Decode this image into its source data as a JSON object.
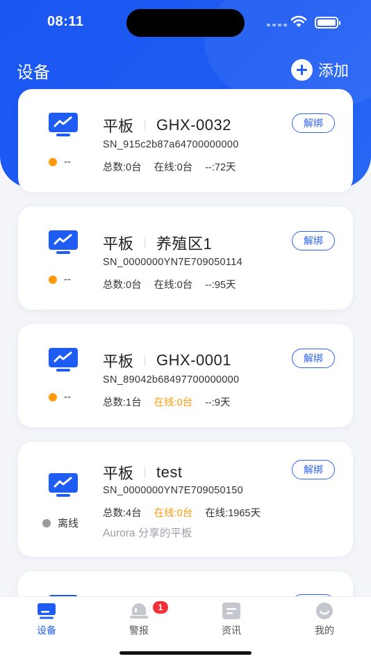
{
  "status_bar": {
    "time": "08:11"
  },
  "header": {
    "title": "设备",
    "add_label": "添加"
  },
  "devices": [
    {
      "type": "平板",
      "name": "GHX-0032",
      "sn": "SN_915c2b87a64700000000",
      "status_text": "--",
      "status_color": "#ff9a0e",
      "stats": [
        {
          "text": "总数:0台",
          "highlight": false
        },
        {
          "text": "在线:0台",
          "highlight": false
        },
        {
          "text": "--:72天",
          "highlight": false
        }
      ],
      "shared": "",
      "unbind_label": "解绑"
    },
    {
      "type": "平板",
      "name": "养殖区1",
      "sn": "SN_0000000YN7E709050114",
      "status_text": "--",
      "status_color": "#ff9a0e",
      "stats": [
        {
          "text": "总数:0台",
          "highlight": false
        },
        {
          "text": "在线:0台",
          "highlight": false
        },
        {
          "text": "--:95天",
          "highlight": false
        }
      ],
      "shared": "",
      "unbind_label": "解绑"
    },
    {
      "type": "平板",
      "name": "GHX-0001",
      "sn": "SN_89042b68497700000000",
      "status_text": "--",
      "status_color": "#ff9a0e",
      "stats": [
        {
          "text": "总数:1台",
          "highlight": false
        },
        {
          "text": "在线:0台",
          "highlight": true
        },
        {
          "text": "--:9天",
          "highlight": false
        }
      ],
      "shared": "",
      "unbind_label": "解绑"
    },
    {
      "type": "平板",
      "name": "test",
      "sn": "SN_0000000YN7E709050150",
      "status_text": "离线",
      "status_color": "#9a9a9a",
      "stats": [
        {
          "text": "总数:4台",
          "highlight": false
        },
        {
          "text": "在线:0台",
          "highlight": true
        },
        {
          "text": "在线:1965天",
          "highlight": false
        }
      ],
      "shared": "Aurora 分享的平板",
      "unbind_label": "解绑"
    }
  ],
  "tabs": [
    {
      "label": "设备",
      "icon": "device-icon",
      "active": true
    },
    {
      "label": "警报",
      "icon": "alarm-icon",
      "active": false,
      "badge": "1"
    },
    {
      "label": "资讯",
      "icon": "news-icon",
      "active": false
    },
    {
      "label": "我的",
      "icon": "profile-icon",
      "active": false
    }
  ],
  "colors": {
    "brand": "#1e5cf3",
    "warning": "#ff9a0e",
    "offline": "#9a9a9a",
    "badge": "#f2313a"
  }
}
